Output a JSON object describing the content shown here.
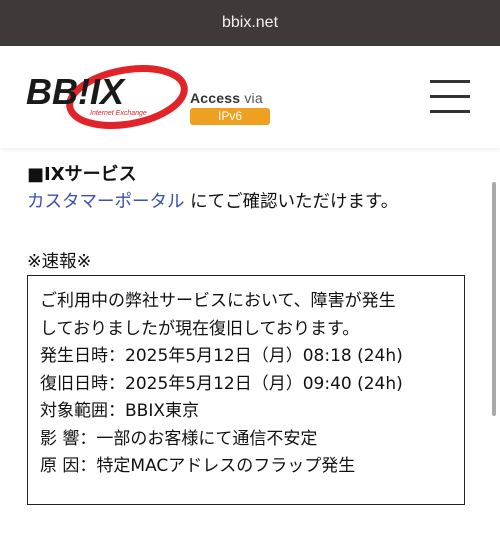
{
  "browser": {
    "url": "bbix.net"
  },
  "header": {
    "logo_main": "BB!IX",
    "logo_sub": "Internet Exchange",
    "access_label": "Access",
    "access_via": "via",
    "ipv6_badge": "IPv6",
    "menu_icon": "hamburger-menu-icon"
  },
  "section": {
    "title": "■IXサービス",
    "portal_link": "カスタマーポータル",
    "portal_suffix": " にてご確認いただけます。"
  },
  "news": {
    "label": "※速報※",
    "lines": [
      "ご利用中の弊社サービスにおいて、障害が発生",
      "しておりましたが現在復旧しております。",
      "発生日時：2025年5月12日（月）08:18 (24h)",
      "復旧日時：2025年5月12日（月）09:40 (24h)",
      "対象範囲：BBIX東京",
      "影 響：一部のお客様にて通信不安定",
      "原 因：特定MACアドレスのフラップ発生"
    ]
  },
  "colors": {
    "url_bar": "#3f3a38",
    "logo_red": "#e0242a",
    "link_blue": "#3a4fb4",
    "ipv6_orange": "#f0a020"
  }
}
